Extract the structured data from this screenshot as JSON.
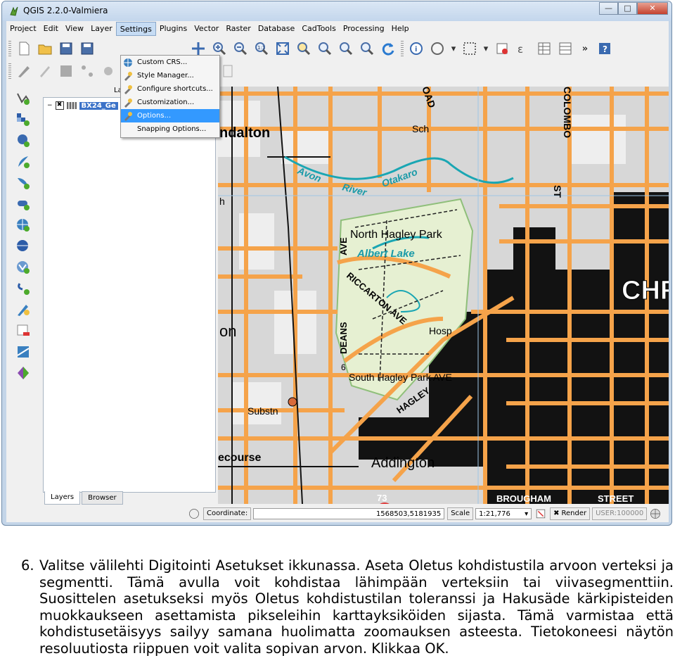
{
  "window": {
    "title": "QGIS 2.2.0-Valmiera",
    "icons": [
      "minimize-icon",
      "maximize-icon",
      "close-icon"
    ]
  },
  "menubar": {
    "items": [
      "Project",
      "Edit",
      "View",
      "Layer",
      "Settings",
      "Plugins",
      "Vector",
      "Raster",
      "Database",
      "CadTools",
      "Processing",
      "Help"
    ],
    "active": "Settings"
  },
  "settings_menu": {
    "items": [
      "Custom CRS...",
      "Style Manager...",
      "Configure shortcuts...",
      "Customization...",
      "Options...",
      "Snapping Options..."
    ],
    "highlighted": "Options..."
  },
  "layers": {
    "row_label": "BX24_Ge",
    "header": "La",
    "tabs": [
      "Layers",
      "Browser"
    ]
  },
  "map": {
    "labels": [
      {
        "text": "ndalton"
      },
      {
        "text": "Avon"
      },
      {
        "text": "River"
      },
      {
        "text": "Otakaro"
      },
      {
        "text": "North Hagley Park"
      },
      {
        "text": "Albert Lake"
      },
      {
        "text": "RICCARTON AVE"
      },
      {
        "text": "Hosp"
      },
      {
        "text": "DEANS"
      },
      {
        "text": "AVE"
      },
      {
        "text": "South Hagley Park AVE"
      },
      {
        "text": "HAGLEY"
      },
      {
        "text": "Substn"
      },
      {
        "text": "ecourse"
      },
      {
        "text": "Addington"
      },
      {
        "text": "73"
      },
      {
        "text": "CHR"
      },
      {
        "text": "COLOMBO"
      },
      {
        "text": "ST"
      },
      {
        "text": "OAD"
      },
      {
        "text": "Sch"
      },
      {
        "text": "6"
      },
      {
        "text": "on"
      },
      {
        "text": "h"
      },
      {
        "text": "BROUGHAM"
      },
      {
        "text": "STREET"
      }
    ]
  },
  "statusbar": {
    "coordinate_label": "Coordinate:",
    "coordinate_value": "1568503,5181935",
    "scale_label": "Scale",
    "scale_value": "1:21,776",
    "render_label": "Render",
    "crs": "USER:100000"
  },
  "instructions": {
    "number": "6.",
    "text": "Valitse välilehti Digitointi Asetukset ikkunassa. Aseta Oletus kohdistustila arvoon verteksi ja segmentti. Tämä avulla voit kohdistaa lähimpään verteksiin tai viivasegmenttiin. Suosittelen asetukseksi myös Oletus kohdistustilan toleranssi ja Hakusäde kärkipisteiden muokkaukseen asettamista pikseleihin karttayksiköiden sijasta. Tämä varmistaa että kohdistusetäisyys sailyy samana huolimatta zoomauksen asteesta. Tietokoneesi näytön resoluutiosta riippuen voit valita sopivan arvon. Klikkaa OK."
  },
  "colors": {
    "map_road": "#f5a34a",
    "map_block": "#111111",
    "map_park": "#e6f0d2",
    "map_water": "#1aa6b3",
    "menu_highlight": "#3399ff"
  }
}
